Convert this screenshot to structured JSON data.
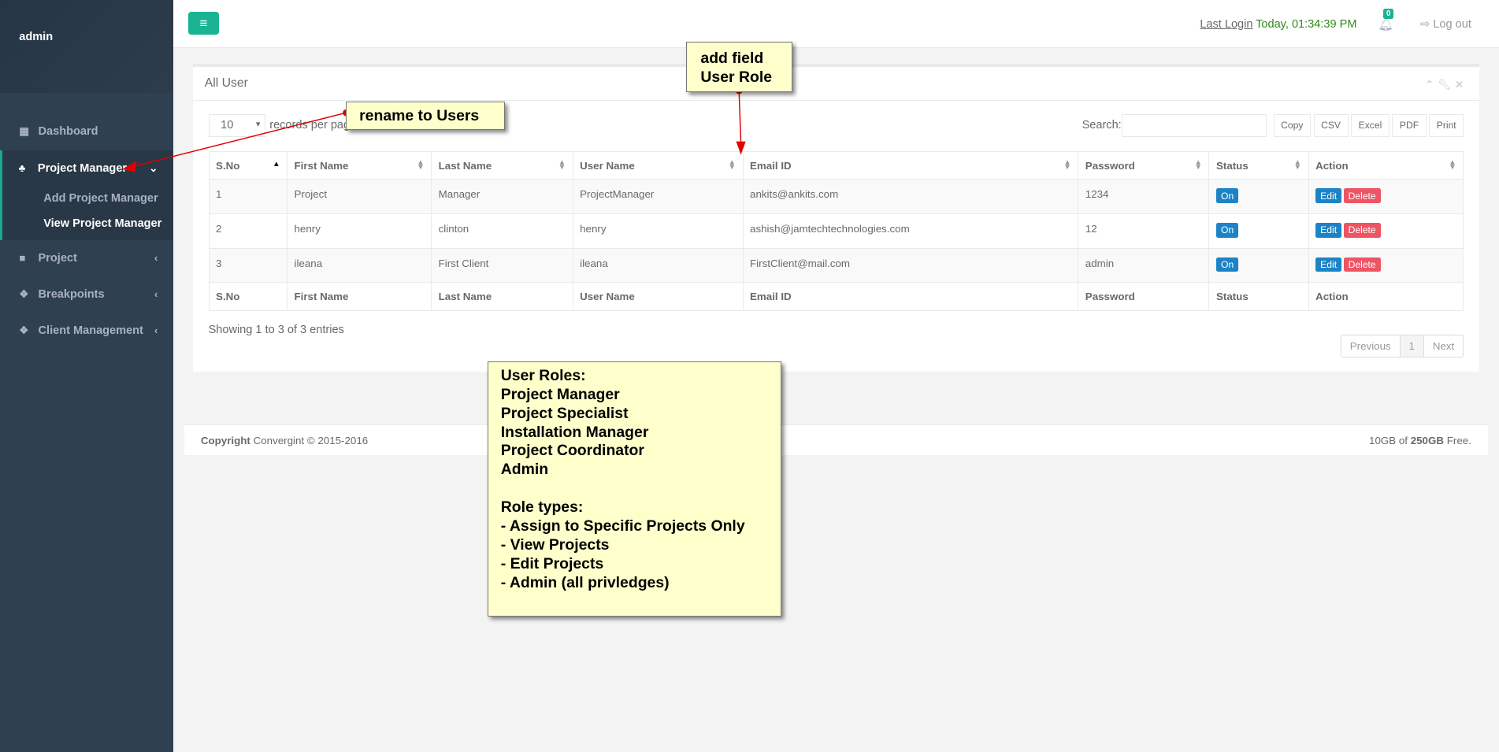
{
  "sidebar": {
    "user": "admin",
    "items": [
      {
        "label": "Dashboard",
        "icon": "dashboard-icon"
      },
      {
        "label": "Project Manager",
        "icon": "sitemap-icon",
        "sub": [
          "Add Project Manager",
          "View Project Manager"
        ]
      },
      {
        "label": "Project",
        "icon": "folder-icon"
      },
      {
        "label": "Breakpoints",
        "icon": "cubes-icon"
      },
      {
        "label": "Client Management",
        "icon": "cubes-icon"
      }
    ]
  },
  "topbar": {
    "last_login_label": "Last Login",
    "last_login_time": "Today, 01:34:39 PM",
    "notifications": "0",
    "logout": "Log out"
  },
  "panel": {
    "title": "All User",
    "length": "10",
    "length_label": "records per page",
    "search_label": "Search:",
    "search_value": "",
    "export_buttons": [
      "Copy",
      "CSV",
      "Excel",
      "PDF",
      "Print"
    ],
    "columns": [
      "S.No",
      "First Name",
      "Last Name",
      "User Name",
      "Email ID",
      "Password",
      "Status",
      "Action"
    ],
    "rows": [
      [
        "1",
        "Project",
        "Manager",
        "ProjectManager",
        "ankits@ankits.com",
        "1234"
      ],
      [
        "2",
        "henry",
        "clinton",
        "henry",
        "ashish@jamtechtechnologies.com",
        "12"
      ],
      [
        "3",
        "ileana",
        "First Client",
        "ileana",
        "FirstClient@mail.com",
        "admin"
      ]
    ],
    "status_label": "On",
    "edit_label": "Edit",
    "delete_label": "Delete",
    "info": "Showing 1 to 3 of 3 entries",
    "pager": {
      "prev": "Previous",
      "page": "1",
      "next": "Next"
    }
  },
  "footer": {
    "copyright_bold": "Copyright",
    "copyright": "Convergint © 2015-2016",
    "storage_pre": "10GB of",
    "storage_bold": "250GB",
    "storage_post": "Free."
  },
  "annotations": {
    "rename": "rename to Users",
    "add_field": [
      "add field",
      "User Role"
    ],
    "roles": [
      "User Roles:",
      "Project Manager",
      "Project Specialist",
      "Installation Manager",
      "Project Coordinator",
      "Admin",
      "",
      "Role types:",
      "- Assign to Specific Projects Only",
      "- View Projects",
      "- Edit Projects",
      "- Admin (all privledges)"
    ]
  },
  "colors": {
    "accent": "#1ab394",
    "sidebar": "#2f4050",
    "primary": "#1c84c6",
    "danger": "#ed5565",
    "annotation": "#ffffcc",
    "arrow": "#e00000"
  }
}
